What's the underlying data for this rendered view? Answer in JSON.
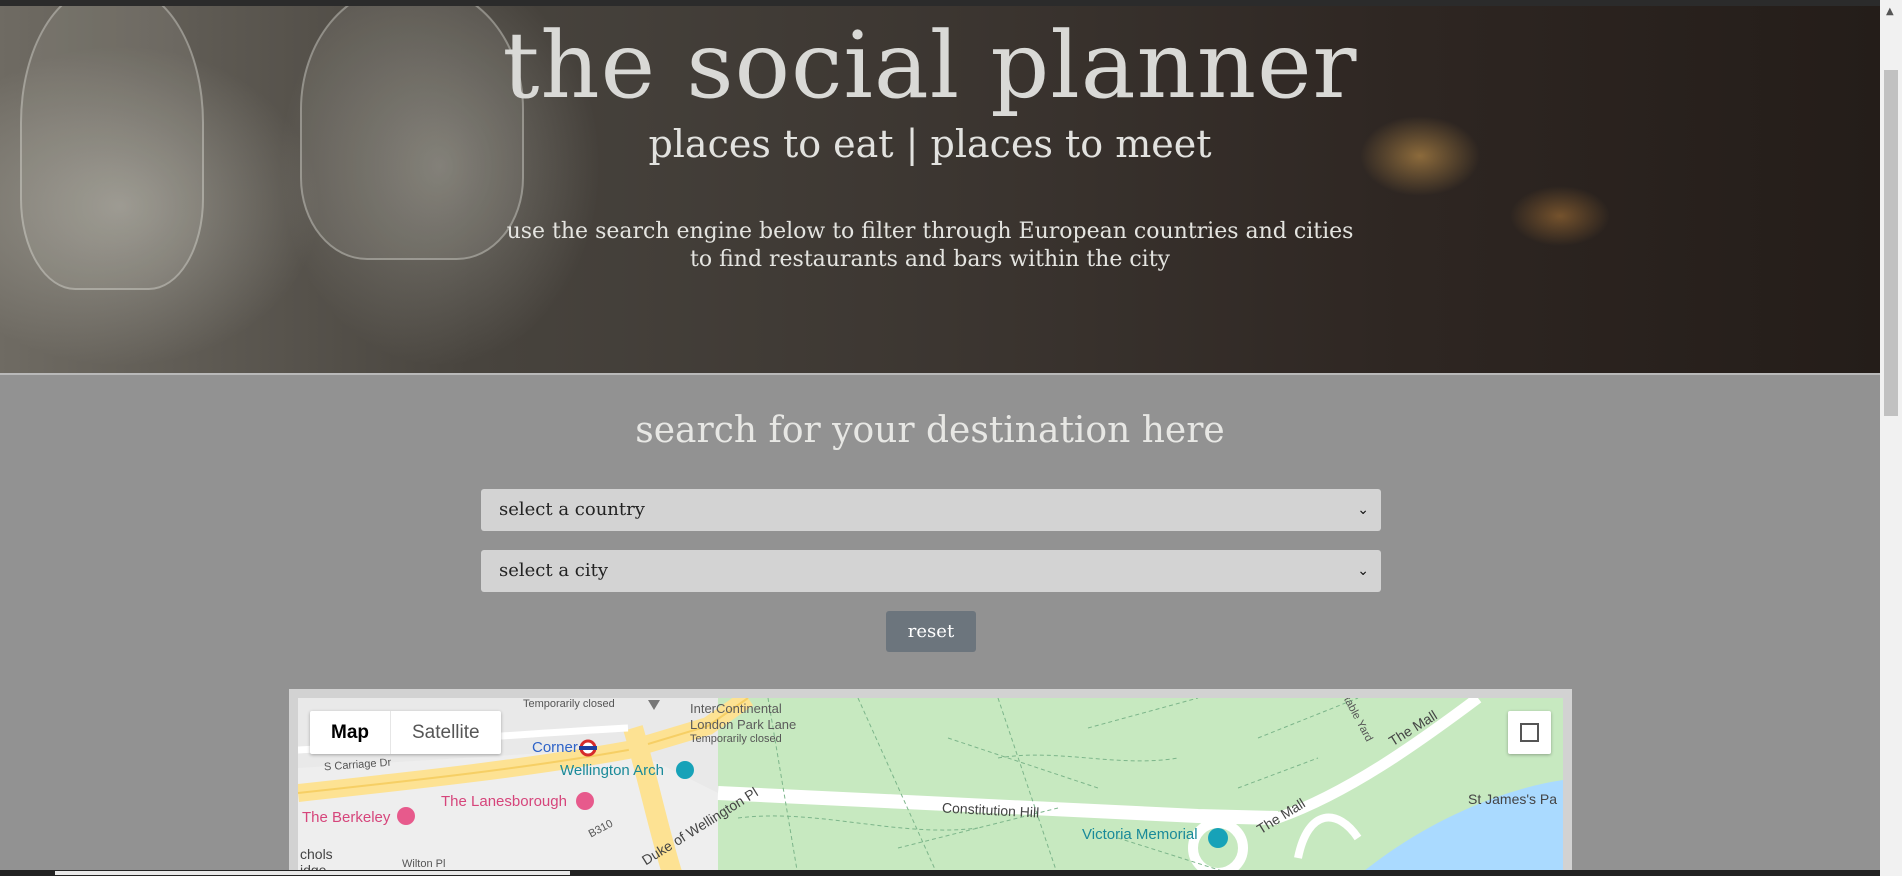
{
  "hero": {
    "title": "the social planner",
    "subtitle": "places to eat | places to meet",
    "description_line1": "use the search engine below to filter through European countries and cities",
    "description_line2": "to find restaurants and bars within the city"
  },
  "search": {
    "heading": "search for your destination here",
    "country_select": "select a country",
    "city_select": "select a city",
    "reset_label": "reset"
  },
  "map": {
    "type_map": "Map",
    "type_satellite": "Satellite",
    "labels": {
      "temporarily_closed_1": "Temporarily closed",
      "intercontinental_1": "InterContinental",
      "intercontinental_2": "London Park Lane",
      "temporarily_closed_2": "Temporarily closed",
      "corner": "Corner",
      "s_carriage_dr": "S Carriage Dr",
      "wellington_arch": "Wellington Arch",
      "lanesborough": "The Lanesborough",
      "berkeley": "The Berkeley",
      "b310": "B310",
      "duke_of_wellington_pl": "Duke of Wellington Pl",
      "constitution_hill": "Constitution Hill",
      "victoria_memorial": "Victoria Memorial",
      "the_mall_1": "The Mall",
      "the_mall_2": "The Mall",
      "stable_yard": "Stable Yard",
      "st_james": "St James's Pa",
      "chols": "chols",
      "idge": "idge",
      "wilton_pl": "Wilton Pl"
    }
  },
  "colors": {
    "page_bg": "#929292",
    "reset_button": "#6c757d",
    "select_bg": "#d3d3d3",
    "park_green": "#c7e9c0",
    "water_blue": "#aadaff"
  },
  "icons": [
    "chevron-down-icon",
    "fullscreen-icon",
    "underground-icon",
    "landmark-icon",
    "hotel-icon",
    "monument-icon"
  ]
}
